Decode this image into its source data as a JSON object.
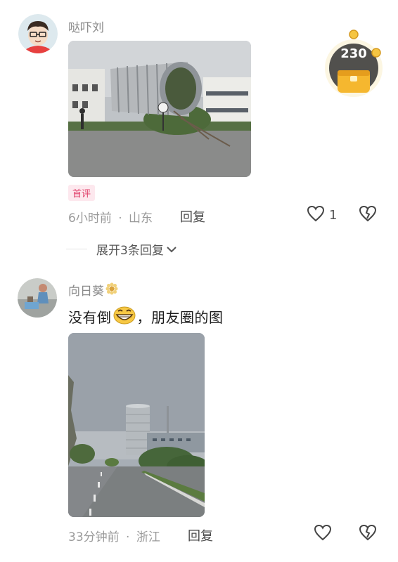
{
  "comments": [
    {
      "username": "哒吓刘",
      "badge": "首评",
      "time": "6小时前",
      "location": "山东",
      "reply_label": "回复",
      "like_count": "1",
      "expand_replies": "展开3条回复"
    },
    {
      "username": "向日葵",
      "text_before": "没有倒",
      "text_after": "，朋友圈的图",
      "time": "33分钟前",
      "location": "浙江",
      "reply_label": "回复"
    }
  ],
  "floating_widget": {
    "count": "230"
  },
  "separator": "·",
  "icons": [
    "heart-outline-icon",
    "broken-heart-icon",
    "chevron-down-icon",
    "grin-emoji-icon",
    "sunflower-icon",
    "gift-bag-icon"
  ]
}
